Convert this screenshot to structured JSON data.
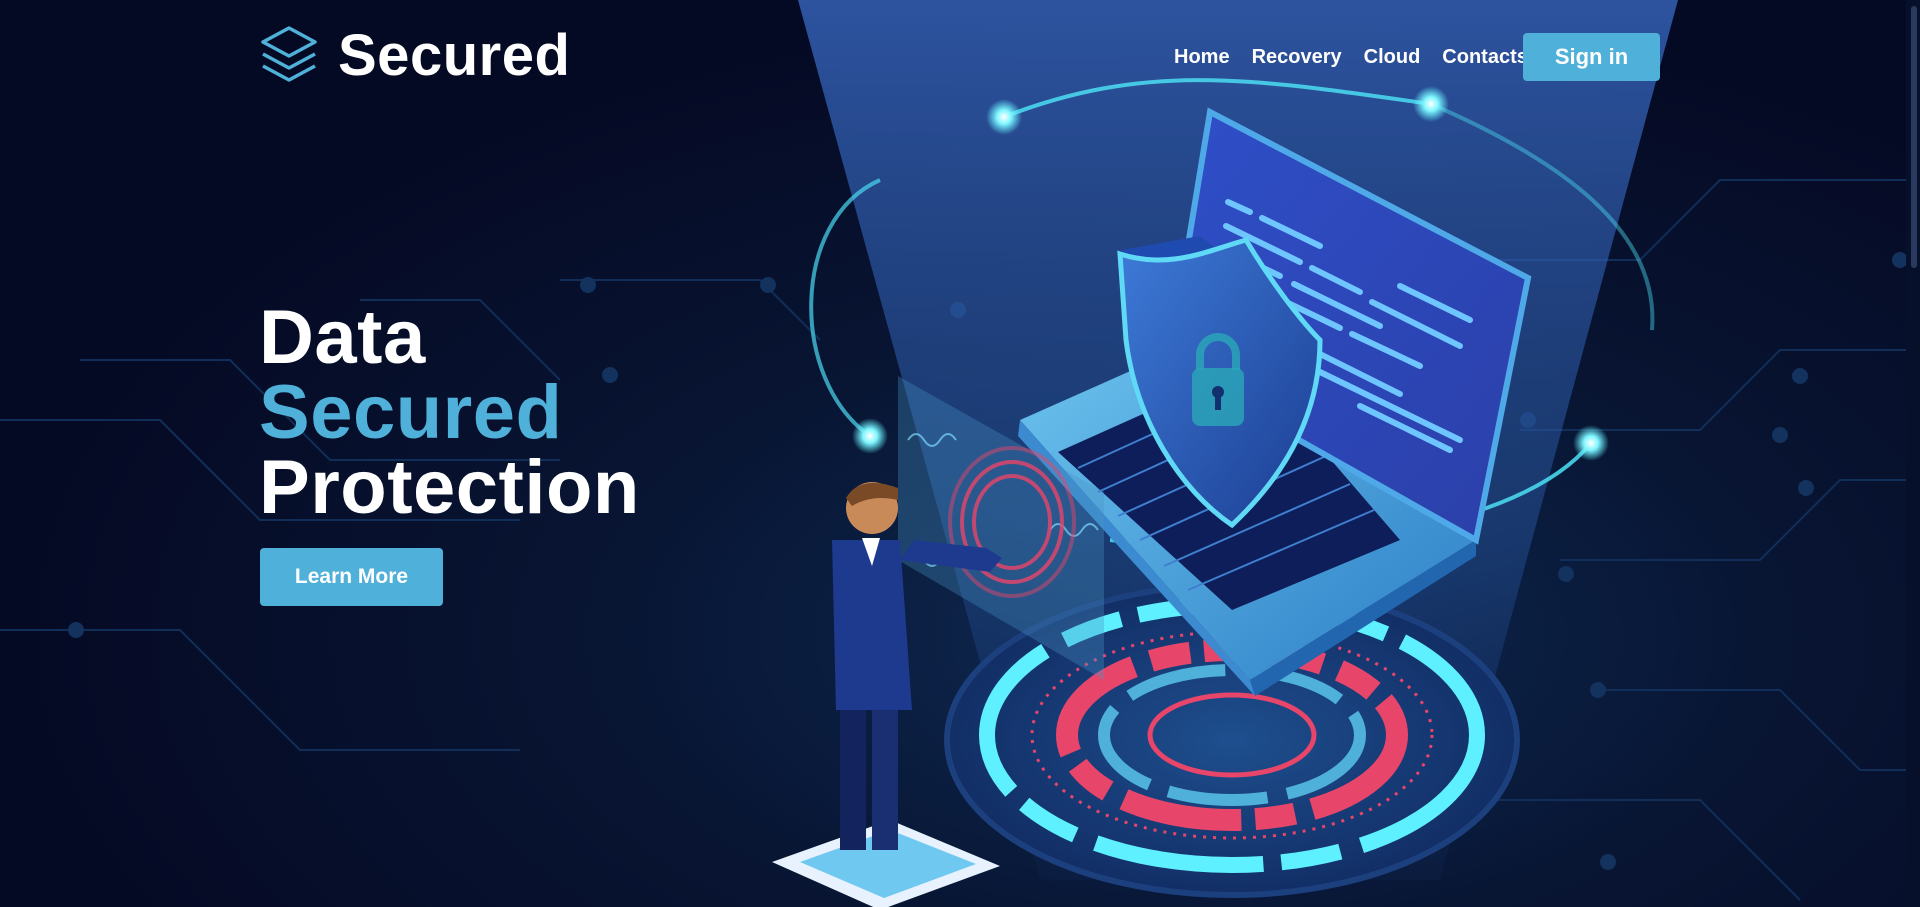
{
  "header": {
    "brand": "Secured",
    "logo_icon": "stacked-layers-icon",
    "nav": [
      {
        "label": "Home"
      },
      {
        "label": "Recovery"
      },
      {
        "label": "Cloud"
      },
      {
        "label": "Contacts"
      }
    ],
    "signin_label": "Sign in"
  },
  "hero": {
    "line1": "Data",
    "line2": "Secured",
    "line3": "Protection",
    "cta_label": "Learn More"
  },
  "illustration": {
    "subject": "isometric-laptop-with-shield-lock",
    "icons": [
      "shield-lock-icon",
      "fingerprint-lock-icon",
      "businessman-figure"
    ]
  },
  "colors": {
    "background": "#050a24",
    "accent": "#4fb0d9",
    "glow": "#5ff0ff",
    "alert_red": "#e8456a",
    "text": "#ffffff"
  }
}
